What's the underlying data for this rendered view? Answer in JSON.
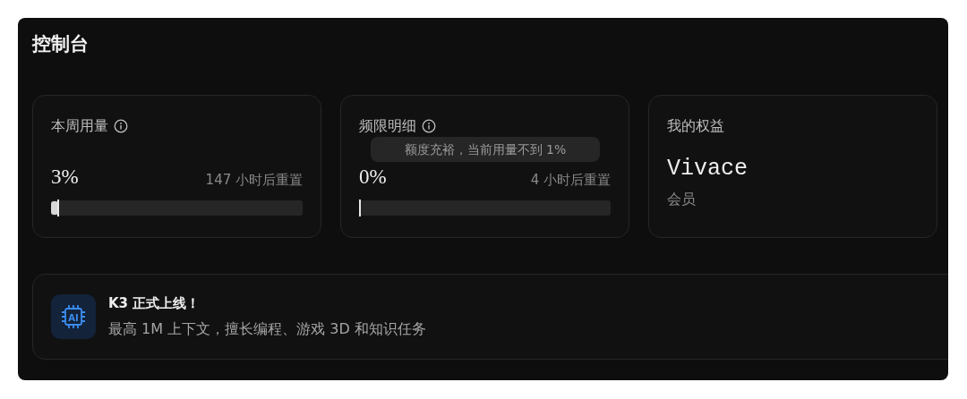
{
  "title": "控制台",
  "cards": [
    {
      "kind": "usage",
      "title": "本周用量",
      "percent": "3%",
      "reset": "147 小时后重置",
      "level": 0.03
    },
    {
      "kind": "usage",
      "title": "频限明细",
      "percent": "0%",
      "reset": "4 小时后重置",
      "level": 0,
      "tooltip": "额度充裕，当前用量不到 1%"
    },
    {
      "kind": "plan",
      "title": "我的权益",
      "plan": "Vivace",
      "plan_label": "会员"
    }
  ],
  "banner": {
    "icon_text": "AI",
    "title": "K3 正式上线！",
    "text": "最高 1M 上下文，擅长编程、游戏 3D 和知识任务"
  }
}
